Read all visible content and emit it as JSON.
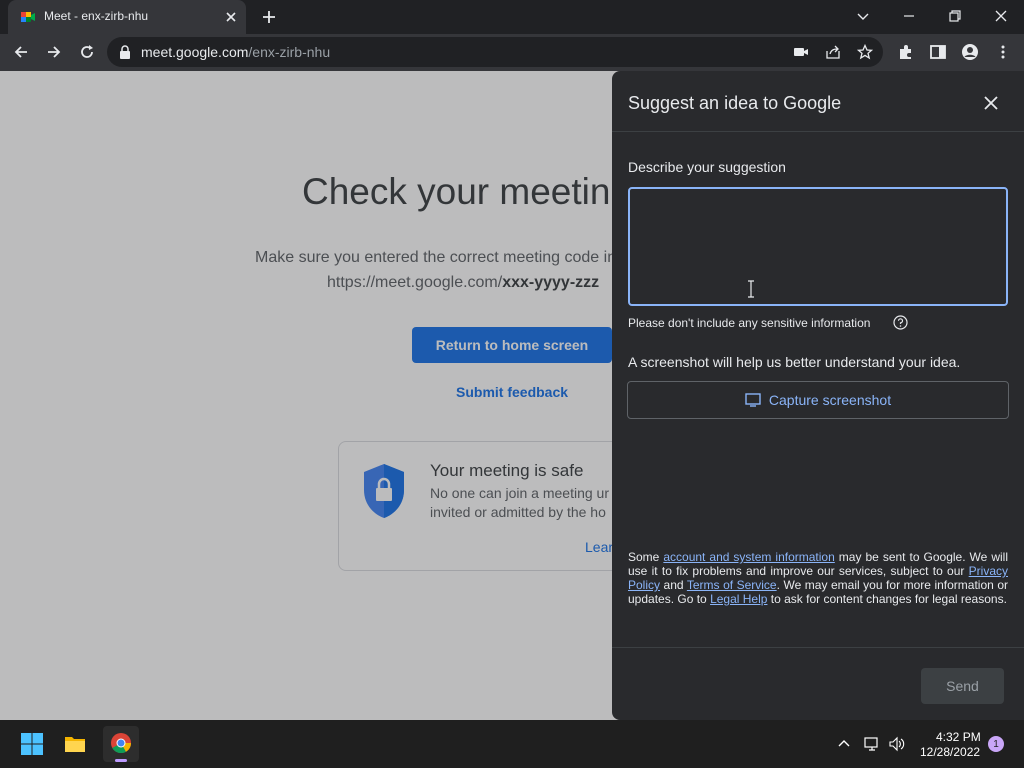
{
  "browser": {
    "tab_title": "Meet - enx-zirb-nhu",
    "url_host": "meet.google.com",
    "url_path": "/enx-zirb-nhu"
  },
  "page": {
    "heading": "Check your meeting",
    "hint_line1": "Make sure you entered the correct meeting code in",
    "hint_line2_prefix": "https://meet.google.com/",
    "hint_line2_code": "xxx-yyyy-zzz",
    "home_button": "Return to home screen",
    "feedback_link": "Submit feedback",
    "safe_title": "Your meeting is safe",
    "safe_line1": "No one can join a meeting ur",
    "safe_line2": "invited or admitted by the ho",
    "learn_more": "Lear"
  },
  "panel": {
    "title": "Suggest an idea to Google",
    "describe_label": "Describe your suggestion",
    "textarea_value": "",
    "sensitive_warning": "Please don't include any sensitive information",
    "screenshot_hint": "A screenshot will help us better understand your idea.",
    "capture_button": "Capture screenshot",
    "legal": {
      "t1": "Some ",
      "link1": "account and system information",
      "t2": " may be sent to Google. We will use it to fix problems and improve our services, subject to our ",
      "link2": "Privacy Policy",
      "t3": " and ",
      "link3": "Terms of Service",
      "t4": ". We may email you for more information or updates. Go to ",
      "link4": "Legal Help",
      "t5": " to ask for content changes for legal reasons."
    },
    "send_button": "Send"
  },
  "taskbar": {
    "time": "4:32 PM",
    "date": "12/28/2022",
    "notification_count": "1"
  },
  "colors": {
    "accent": "#1a73e8",
    "panel_link": "#8ab4f8",
    "panel_bg": "#292a2d",
    "browser_bg": "#202124"
  }
}
